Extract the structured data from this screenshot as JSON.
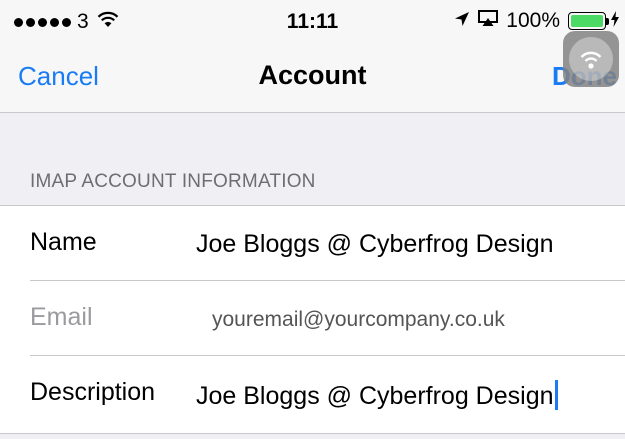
{
  "status_bar": {
    "signal_icon": "signal-dots-icon",
    "carrier": "3",
    "wifi_icon": "wifi-icon",
    "time": "11:11",
    "location_icon": "location-arrow-icon",
    "airplay_icon": "airplay-icon",
    "battery_percent": "100%",
    "battery_level": 1.0,
    "battery_color": "#4cd964",
    "charging_icon": "bolt-icon"
  },
  "nav": {
    "cancel_label": "Cancel",
    "title": "Account",
    "done_label": "Done",
    "accent_color": "#1a7cf5"
  },
  "assistive_touch_icon": "assistive-touch-icon",
  "section": {
    "header": "IMAP ACCOUNT INFORMATION"
  },
  "fields": {
    "name": {
      "label": "Name",
      "value": "Joe Bloggs @ Cyberfrog Design"
    },
    "email": {
      "label": "Email",
      "placeholder": "youremail@yourcompany.co.uk"
    },
    "description": {
      "label": "Description",
      "value": "Joe Bloggs @ Cyberfrog Design"
    }
  }
}
